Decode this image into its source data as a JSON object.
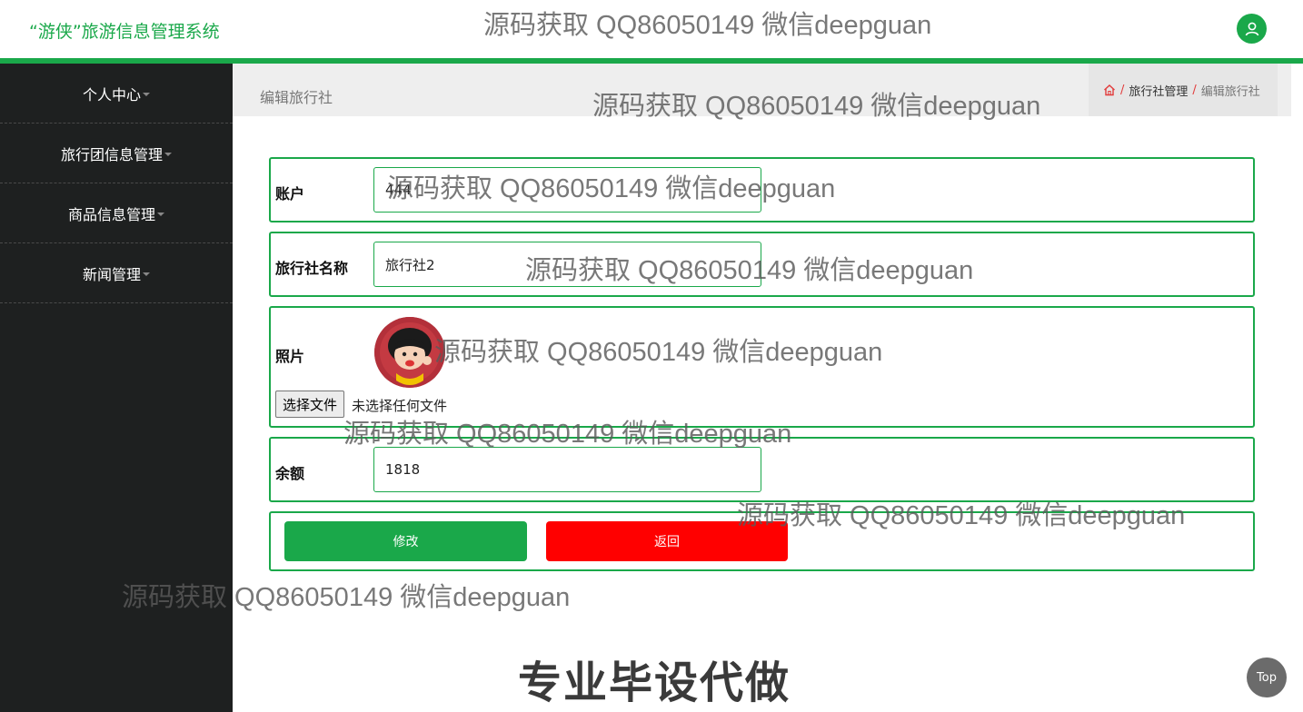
{
  "header": {
    "brand": "“游侠”旅游信息管理系统"
  },
  "sidebar": {
    "items": [
      {
        "label": "个人中心"
      },
      {
        "label": "旅行团信息管理"
      },
      {
        "label": "商品信息管理"
      },
      {
        "label": "新闻管理"
      }
    ]
  },
  "page": {
    "title": "编辑旅行社",
    "breadcrumb": {
      "section": "旅行社管理",
      "current": "编辑旅行社"
    }
  },
  "form": {
    "account": {
      "label": "账户",
      "value": "444"
    },
    "agency_name": {
      "label": "旅行社名称",
      "value": "旅行社2"
    },
    "photo": {
      "label": "照片",
      "file_button": "选择文件",
      "file_status": "未选择任何文件"
    },
    "balance": {
      "label": "余额",
      "value": "1818"
    },
    "submit_label": "修改",
    "back_label": "返回"
  },
  "watermark": "源码获取 QQ86050149 微信deepguan",
  "promo": "专业毕设代做",
  "totop_label": "Top",
  "colors": {
    "accent": "#1aa84a",
    "danger": "#ff0000",
    "sidebar": "#1e2020"
  }
}
